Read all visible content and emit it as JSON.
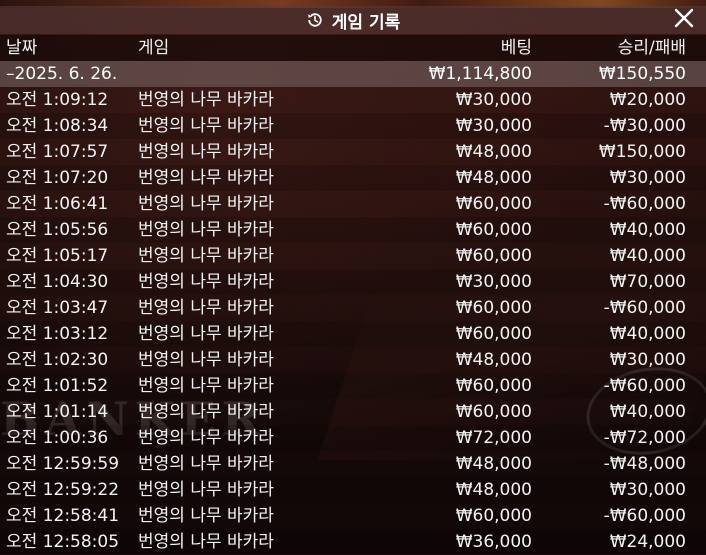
{
  "header": {
    "title": "게임 기록"
  },
  "columns": {
    "date": "날짜",
    "game": "게임",
    "bet": "베팅",
    "win_loss": "승리/패배"
  },
  "summary": {
    "date": "–2025. 6. 26.",
    "bet": "₩1,114,800",
    "win_loss": "₩150,550"
  },
  "rows": [
    {
      "time": "오전 1:09:12",
      "game": "번영의 나무 바카라",
      "bet": "₩30,000",
      "win_loss": "₩20,000"
    },
    {
      "time": "오전 1:08:34",
      "game": "번영의 나무 바카라",
      "bet": "₩30,000",
      "win_loss": "-₩30,000"
    },
    {
      "time": "오전 1:07:57",
      "game": "번영의 나무 바카라",
      "bet": "₩48,000",
      "win_loss": "₩150,000"
    },
    {
      "time": "오전 1:07:20",
      "game": "번영의 나무 바카라",
      "bet": "₩48,000",
      "win_loss": "₩30,000"
    },
    {
      "time": "오전 1:06:41",
      "game": "번영의 나무 바카라",
      "bet": "₩60,000",
      "win_loss": "-₩60,000"
    },
    {
      "time": "오전 1:05:56",
      "game": "번영의 나무 바카라",
      "bet": "₩60,000",
      "win_loss": "₩40,000"
    },
    {
      "time": "오전 1:05:17",
      "game": "번영의 나무 바카라",
      "bet": "₩60,000",
      "win_loss": "₩40,000"
    },
    {
      "time": "오전 1:04:30",
      "game": "번영의 나무 바카라",
      "bet": "₩30,000",
      "win_loss": "₩70,000"
    },
    {
      "time": "오전 1:03:47",
      "game": "번영의 나무 바카라",
      "bet": "₩60,000",
      "win_loss": "-₩60,000"
    },
    {
      "time": "오전 1:03:12",
      "game": "번영의 나무 바카라",
      "bet": "₩60,000",
      "win_loss": "₩40,000"
    },
    {
      "time": "오전 1:02:30",
      "game": "번영의 나무 바카라",
      "bet": "₩48,000",
      "win_loss": "₩30,000"
    },
    {
      "time": "오전 1:01:52",
      "game": "번영의 나무 바카라",
      "bet": "₩60,000",
      "win_loss": "-₩60,000"
    },
    {
      "time": "오전 1:01:14",
      "game": "번영의 나무 바카라",
      "bet": "₩60,000",
      "win_loss": "₩40,000"
    },
    {
      "time": "오전 1:00:36",
      "game": "번영의 나무 바카라",
      "bet": "₩72,000",
      "win_loss": "-₩72,000"
    },
    {
      "time": "오전 12:59:59",
      "game": "번영의 나무 바카라",
      "bet": "₩48,000",
      "win_loss": "-₩48,000"
    },
    {
      "time": "오전 12:59:22",
      "game": "번영의 나무 바카라",
      "bet": "₩48,000",
      "win_loss": "₩30,000"
    },
    {
      "time": "오전 12:58:41",
      "game": "번영의 나무 바카라",
      "bet": "₩60,000",
      "win_loss": "-₩60,000"
    },
    {
      "time": "오전 12:58:05",
      "game": "번영의 나무 바카라",
      "bet": "₩36,000",
      "win_loss": "₩24,000"
    }
  ],
  "background": {
    "table_label": "BANKER"
  },
  "icons": {
    "history": "history-icon",
    "close": "close-icon"
  }
}
